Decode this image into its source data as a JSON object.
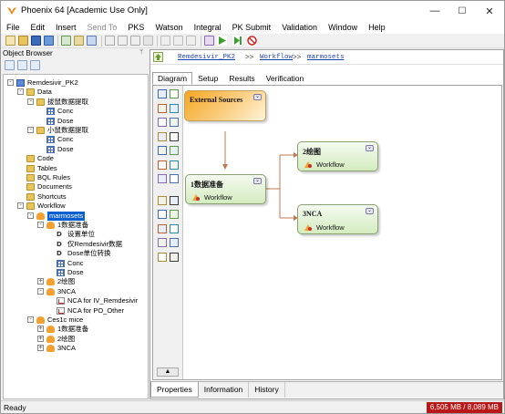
{
  "window": {
    "title": "Phoenix 64 [Academic Use Only]",
    "minimize": "—",
    "maximize": "☐",
    "close": "✕"
  },
  "menu": [
    {
      "label": "File",
      "enabled": true
    },
    {
      "label": "Edit",
      "enabled": true
    },
    {
      "label": "Insert",
      "enabled": true
    },
    {
      "label": "Send To",
      "enabled": false
    },
    {
      "label": "PKS",
      "enabled": true
    },
    {
      "label": "Watson",
      "enabled": true
    },
    {
      "label": "Integral",
      "enabled": true
    },
    {
      "label": "PK Submit",
      "enabled": true
    },
    {
      "label": "Validation",
      "enabled": true
    },
    {
      "label": "Window",
      "enabled": true
    },
    {
      "label": "Help",
      "enabled": true
    }
  ],
  "object_browser": {
    "header": "Object Browser",
    "pin": "ᛘ",
    "tree": [
      {
        "label": "Remdesivir_PK2",
        "icon": "project-icon",
        "expander": "-"
      },
      {
        "label": "Data",
        "icon": "folder-icon",
        "expander": "-"
      },
      {
        "label": "拔鼠数据提取",
        "icon": "folder-icon",
        "expander": "-"
      },
      {
        "label": "Conc",
        "icon": "table-icon"
      },
      {
        "label": "Dose",
        "icon": "table-icon"
      },
      {
        "label": "小鼠数据提取",
        "icon": "folder-icon",
        "expander": "-"
      },
      {
        "label": "Conc",
        "icon": "table-icon"
      },
      {
        "label": "Dose",
        "icon": "table-icon"
      },
      {
        "label": "Code",
        "icon": "folder-icon"
      },
      {
        "label": "Tables",
        "icon": "folder-icon"
      },
      {
        "label": "BQL Rules",
        "icon": "folder-icon"
      },
      {
        "label": "Documents",
        "icon": "folder-icon"
      },
      {
        "label": "Shortcuts",
        "icon": "folder-icon"
      },
      {
        "label": "Workflow",
        "icon": "folder-icon",
        "expander": "-"
      },
      {
        "label": "marmosets",
        "icon": "workflow-icon",
        "expander": "-",
        "selected": true
      },
      {
        "label": "1数据准备",
        "icon": "workflow-icon",
        "expander": "-"
      },
      {
        "label": "设置单位",
        "icon": "dw-icon"
      },
      {
        "label": "仅Remdesivir数据",
        "icon": "dw-icon"
      },
      {
        "label": "Dose单位转换",
        "icon": "dw-icon"
      },
      {
        "label": "Conc",
        "icon": "table-icon"
      },
      {
        "label": "Dose",
        "icon": "table-icon"
      },
      {
        "label": "2绘图",
        "icon": "workflow-icon",
        "expander": "+"
      },
      {
        "label": "3NCA",
        "icon": "workflow-icon",
        "expander": "-"
      },
      {
        "label": "NCA for IV_Remdesivir",
        "icon": "nca-icon"
      },
      {
        "label": "NCA for PO_Other",
        "icon": "nca-icon"
      },
      {
        "label": "Ces1c mice",
        "icon": "workflow-icon",
        "expander": "-"
      },
      {
        "label": "1数据准备",
        "icon": "workflow-icon",
        "expander": "+"
      },
      {
        "label": "2绘图",
        "icon": "workflow-icon",
        "expander": "+"
      },
      {
        "label": "3NCA",
        "icon": "workflow-icon",
        "expander": "+"
      }
    ]
  },
  "breadcrumb": {
    "items": [
      "Remdesivir_PK2",
      "Workflow",
      "marmosets"
    ],
    "separator": ">>"
  },
  "tabs": [
    "Diagram",
    "Setup",
    "Results",
    "Verification"
  ],
  "diagram": {
    "external_sources": {
      "title": "External Sources",
      "chevron": "⌄"
    },
    "prep": {
      "title": "1数据准备",
      "subtitle": "Workflow",
      "chevron": "⌄"
    },
    "plot": {
      "title": "2绘图",
      "subtitle": "Workflow",
      "chevron": "⌄"
    },
    "nca": {
      "title": "3NCA",
      "subtitle": "Workflow",
      "chevron": "⌄"
    }
  },
  "bottom_tabs": [
    "Properties",
    "Information",
    "History"
  ],
  "status": {
    "text": "Ready",
    "memory": "6,505 MB / 8,089 MB"
  },
  "colors": {
    "selection": "#0a5fd0",
    "external_box": "#f5a623",
    "workflow_box": "#d8ecc8",
    "memory_bg": "#b81818",
    "link": "#1d3fb4"
  }
}
